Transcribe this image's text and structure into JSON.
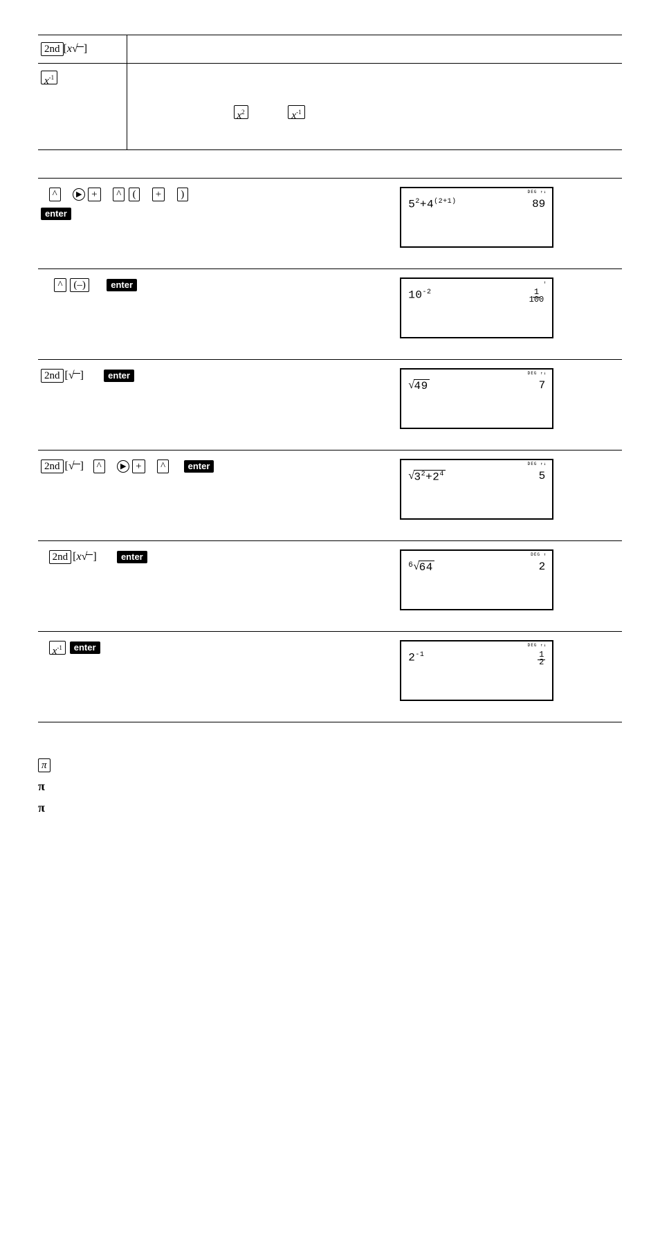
{
  "key_labels": {
    "second": "2nd",
    "enter": "enter",
    "xroot_bracket": "[<span class='italic-x'>x</span>√<span style='display:inline-block;border-top:1px solid #000;width:10px;height:4px;margin-left:-2px;'></span>]",
    "sqrt_bracket": "[√<span style='display:inline-block;border-top:1px solid #000;width:10px;height:4px;margin-left:-2px;'></span>]",
    "x_inv": "<span class='italic-x'>x</span><sup style='font-size:10px'>-1</sup>",
    "x_sq": "<span class='italic-x'>x</span><sup style='font-size:10px'>2</sup>",
    "caret": "^",
    "plus": "+",
    "lparen": "(",
    "rparen": ")",
    "neg": "(–)",
    "pi": "π"
  },
  "top_table": {
    "row2_inline_keys": [
      "x_sq",
      "x_inv"
    ]
  },
  "example_rows": [
    {
      "indicator": "DEG   ↑↓",
      "input_html": "5<sup style='font-size:10px'>2</sup>+4<sup style='font-size:10px'>(2+1)</sup>",
      "output_html": "89"
    },
    {
      "indicator": "↑",
      "input_html": "10<sup style='font-size:10px'>-2</sup>",
      "output_html": "<span class='frac'><span class='num'>1</span><br><span class='den'>100</span></span>"
    },
    {
      "indicator": "DEG   ↑↓",
      "input_html": "<span class='sqrt-block'><span class='sqrt-sym'>√</span><span class='sqrt-rad'>49</span></span>",
      "output_html": "7"
    },
    {
      "indicator": "DEG   ↑↓",
      "input_html": "<span class='sqrt-block'><span class='sqrt-sym'>√</span><span class='sqrt-rad'>3<span class='tinysup'>2</span>+2<span class='tinysup'>4</span></span></span>",
      "output_html": "5"
    },
    {
      "indicator": "DEG   ↑",
      "input_html": "<span style='font-size:11px;vertical-align:4px'>6</span><span class='sqrt-block'><span class='sqrt-sym'>√</span><span class='sqrt-rad'>64</span></span>",
      "output_html": "2"
    },
    {
      "indicator": "DEG   ↑↓",
      "input_html": "2<sup style='font-size:10px'>-1</sup>",
      "output_html": "<span class='frac'><span class='num'>1</span><br><span class='den'>2</span></span>"
    }
  ],
  "pi_section": {
    "boxed": "π",
    "lines": [
      "π",
      "π"
    ]
  }
}
